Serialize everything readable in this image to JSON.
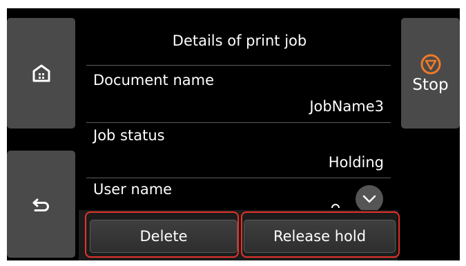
{
  "header": {
    "title": "Details of print job"
  },
  "side": {
    "home_icon": "home-icon",
    "back_icon": "back-arrow-icon",
    "stop_label": "Stop",
    "stop_icon": "stop-icon"
  },
  "details": [
    {
      "label": "Document name",
      "value": "JobName3"
    },
    {
      "label": "Job status",
      "value": "Holding"
    },
    {
      "label": "User name"
    }
  ],
  "scroll": {
    "icon": "chevron-down-icon"
  },
  "actions": {
    "delete_label": "Delete",
    "release_label": "Release hold"
  },
  "colors": {
    "highlight": "#e5332a",
    "stop_accent": "#f07a28"
  }
}
